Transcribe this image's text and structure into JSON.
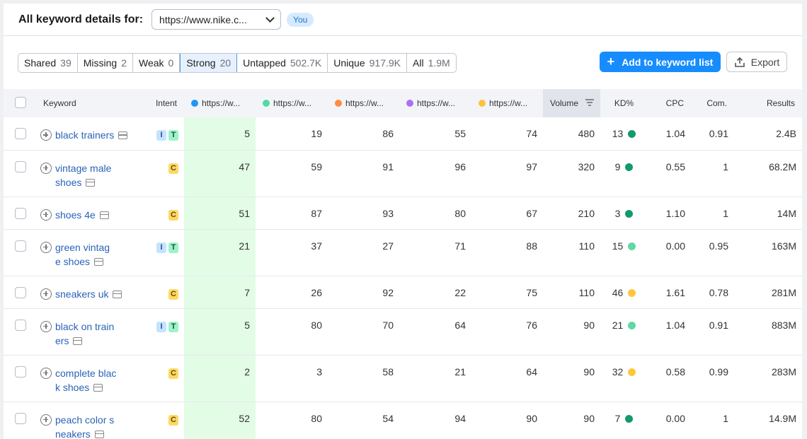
{
  "header": {
    "title": "All keyword details for:",
    "domain": "https://www.nike.c...",
    "you_badge": "You"
  },
  "filters": [
    {
      "label": "Shared",
      "count": "39",
      "active": false
    },
    {
      "label": "Missing",
      "count": "2",
      "active": false
    },
    {
      "label": "Weak",
      "count": "0",
      "active": false
    },
    {
      "label": "Strong",
      "count": "20",
      "active": true
    },
    {
      "label": "Untapped",
      "count": "502.7K",
      "active": false
    },
    {
      "label": "Unique",
      "count": "917.9K",
      "active": false
    },
    {
      "label": "All",
      "count": "1.9M",
      "active": false
    }
  ],
  "actions": {
    "add_label": "Add to keyword list",
    "export_label": "Export"
  },
  "colors": {
    "accent": "#168cff",
    "highlight": "#e3fce6",
    "kd_green_dark": "#0f9b6a",
    "kd_green_light": "#5fd8a3",
    "kd_yellow": "#ffc53d"
  },
  "columns": {
    "keyword": "Keyword",
    "intent": "Intent",
    "domains": [
      {
        "label": "https://w...",
        "color": "#2196f3"
      },
      {
        "label": "https://w...",
        "color": "#4fdba3"
      },
      {
        "label": "https://w...",
        "color": "#ff8b3d"
      },
      {
        "label": "https://w...",
        "color": "#a873f0"
      },
      {
        "label": "https://w...",
        "color": "#ffc13d"
      }
    ],
    "volume": "Volume",
    "kd": "KD%",
    "cpc": "CPC",
    "com": "Com.",
    "results": "Results"
  },
  "rows": [
    {
      "line1": "black trainers",
      "line2": "",
      "intent": [
        "I",
        "T"
      ],
      "pos": [
        "5",
        "19",
        "86",
        "55",
        "74"
      ],
      "volume": "480",
      "kd": "13",
      "kd_color": "#0f9b6a",
      "cpc": "1.04",
      "com": "0.91",
      "results": "2.4B"
    },
    {
      "line1": "vintage male",
      "line2": "shoes",
      "intent": [
        "C"
      ],
      "pos": [
        "47",
        "59",
        "91",
        "96",
        "97"
      ],
      "volume": "320",
      "kd": "9",
      "kd_color": "#0f9b6a",
      "cpc": "0.55",
      "com": "1",
      "results": "68.2M"
    },
    {
      "line1": "shoes 4e",
      "line2": "",
      "intent": [
        "C"
      ],
      "pos": [
        "51",
        "87",
        "93",
        "80",
        "67"
      ],
      "volume": "210",
      "kd": "3",
      "kd_color": "#0f9b6a",
      "cpc": "1.10",
      "com": "1",
      "results": "14M"
    },
    {
      "line1": "green vintag",
      "line2": "e shoes",
      "intent": [
        "I",
        "T"
      ],
      "pos": [
        "21",
        "37",
        "27",
        "71",
        "88"
      ],
      "volume": "110",
      "kd": "15",
      "kd_color": "#5fd8a3",
      "cpc": "0.00",
      "com": "0.95",
      "results": "163M"
    },
    {
      "line1": "sneakers uk",
      "line2": "",
      "intent": [
        "C"
      ],
      "pos": [
        "7",
        "26",
        "92",
        "22",
        "75"
      ],
      "volume": "110",
      "kd": "46",
      "kd_color": "#ffc53d",
      "cpc": "1.61",
      "com": "0.78",
      "results": "281M"
    },
    {
      "line1": "black on train",
      "line2": "ers",
      "intent": [
        "I",
        "T"
      ],
      "pos": [
        "5",
        "80",
        "70",
        "64",
        "76"
      ],
      "volume": "90",
      "kd": "21",
      "kd_color": "#5fd8a3",
      "cpc": "1.04",
      "com": "0.91",
      "results": "883M"
    },
    {
      "line1": "complete blac",
      "line2": "k shoes",
      "intent": [
        "C"
      ],
      "pos": [
        "2",
        "3",
        "58",
        "21",
        "64"
      ],
      "volume": "90",
      "kd": "32",
      "kd_color": "#ffc53d",
      "cpc": "0.58",
      "com": "0.99",
      "results": "283M"
    },
    {
      "line1": "peach color s",
      "line2": "neakers",
      "intent": [
        "C"
      ],
      "pos": [
        "52",
        "80",
        "54",
        "94",
        "90"
      ],
      "volume": "90",
      "kd": "7",
      "kd_color": "#0f9b6a",
      "cpc": "0.00",
      "com": "1",
      "results": "14.9M"
    }
  ]
}
